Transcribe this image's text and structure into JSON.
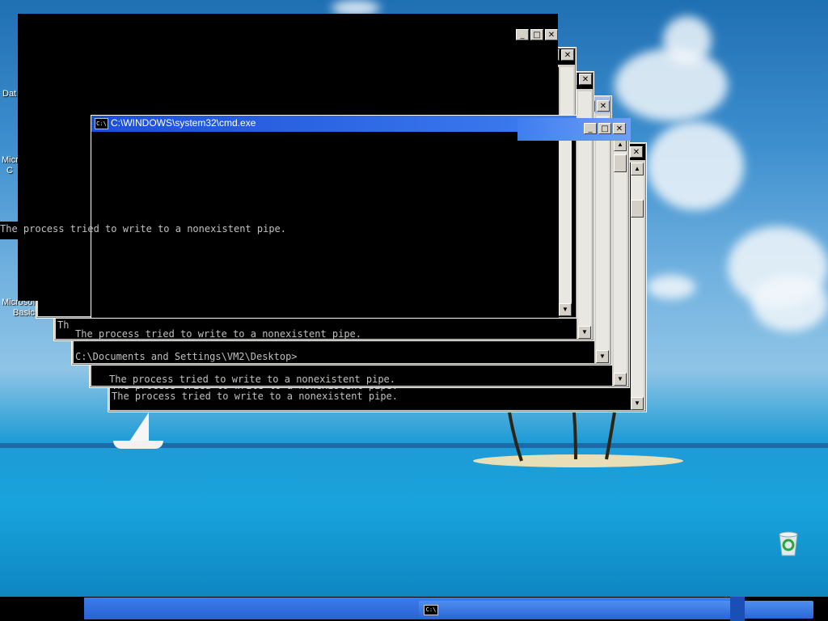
{
  "desktop": {
    "icons": [
      {
        "label": "Dat"
      },
      {
        "label": "Microsof"
      },
      {
        "label": "C"
      },
      {
        "label": "Microsoft"
      },
      {
        "label": "Basic"
      }
    ]
  },
  "windows": {
    "title": "C:\\WINDOWS\\system32\\cmd.exe",
    "icon_text": "C:\\",
    "buttons": {
      "minimize": "_",
      "maximize": "□",
      "close": "✕"
    },
    "pipe_error": "The process tried to write to a nonexistent pipe.",
    "prompt": "C:\\Documents and Settings\\VM2\\Desktop>",
    "prompt_short": "C:\\Documents and Settings\\VM2\\Desktop>"
  },
  "scroll": {
    "up": "▲",
    "down": "▼"
  },
  "taskbar": {
    "button_icon": "C:\\"
  },
  "colors": {
    "titlebar_active": "#2a62d3",
    "console_bg": "#000000",
    "console_text": "#c0c0c0",
    "taskbar": "#2a62d3"
  },
  "recycle_bin_icon": "recycle-bin-icon"
}
